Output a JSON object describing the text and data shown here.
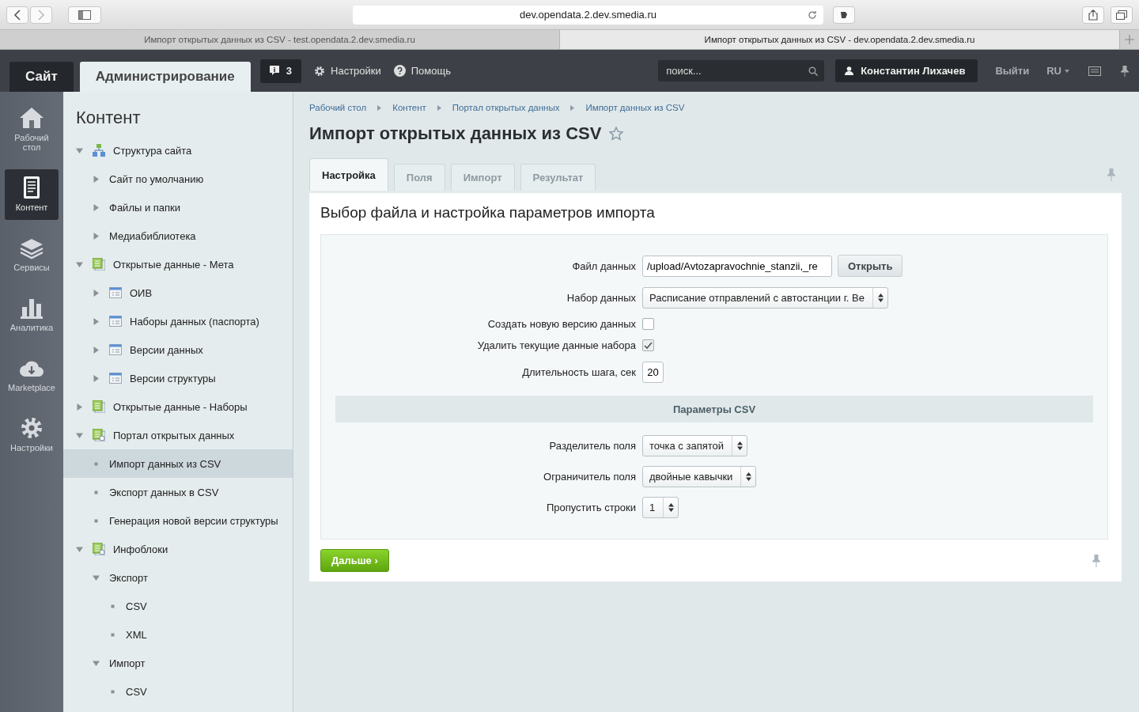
{
  "browser": {
    "url": "dev.opendata.2.dev.smedia.ru",
    "tabs": [
      {
        "title": "Импорт открытых данных из CSV - test.opendata.2.dev.smedia.ru",
        "selected": false
      },
      {
        "title": "Импорт открытых данных из CSV - dev.opendata.2.dev.smedia.ru",
        "selected": true
      }
    ]
  },
  "header": {
    "tabs": [
      {
        "label": "Сайт",
        "selected": false
      },
      {
        "label": "Администрирование",
        "selected": true
      }
    ],
    "notifications": "3",
    "settings": "Настройки",
    "help": "Помощь",
    "search": {
      "placeholder": "поиск..."
    },
    "user": "Константин Лихачев",
    "logout": "Выйти",
    "language": "RU"
  },
  "rail": [
    {
      "label": "Рабочий стол",
      "kind": "house",
      "selected": false
    },
    {
      "label": "Контент",
      "kind": "document",
      "selected": true
    },
    {
      "label": "Сервисы",
      "kind": "layers",
      "selected": false
    },
    {
      "label": "Аналитика",
      "kind": "chart",
      "selected": false
    },
    {
      "label": "Marketplace",
      "kind": "cloud",
      "selected": false
    },
    {
      "label": "Настройки",
      "kind": "gear",
      "selected": false
    }
  ],
  "sidebar": {
    "title": "Контент",
    "items": [
      {
        "label": "Структура сайта",
        "kind": "structure",
        "expanded": true,
        "selected": false,
        "children": [
          {
            "label": "Сайт по умолчанию",
            "kind": "plain",
            "expanded": false,
            "selected": false
          },
          {
            "label": "Файлы и папки",
            "kind": "plain",
            "expanded": false,
            "selected": false
          },
          {
            "label": "Медиабиблиотека",
            "kind": "plain",
            "expanded": false,
            "selected": false
          }
        ]
      },
      {
        "label": "Открытые данные - Мета",
        "kind": "module",
        "expanded": true,
        "selected": false,
        "children": [
          {
            "label": "ОИВ",
            "kind": "table",
            "expanded": false,
            "selected": false
          },
          {
            "label": "Наборы данных (паспорта)",
            "kind": "table",
            "expanded": false,
            "selected": false
          },
          {
            "label": "Версии данных",
            "kind": "table",
            "expanded": false,
            "selected": false
          },
          {
            "label": "Версии структуры",
            "kind": "table",
            "expanded": false,
            "selected": false
          }
        ]
      },
      {
        "label": "Открытые данные - Наборы",
        "kind": "module",
        "expanded": false,
        "selected": false
      },
      {
        "label": "Портал открытых данных",
        "kind": "portal",
        "expanded": true,
        "selected": false,
        "children": [
          {
            "label": "Импорт данных из CSV",
            "kind": "leaf",
            "selected": true
          },
          {
            "label": "Экспорт данных в CSV",
            "kind": "leaf",
            "selected": false
          },
          {
            "label": "Генерация новой версии структуры",
            "kind": "leaf",
            "selected": false
          }
        ]
      },
      {
        "label": "Инфоблоки",
        "kind": "portal",
        "expanded": true,
        "selected": false,
        "children": [
          {
            "label": "Экспорт",
            "kind": "plain",
            "expanded": true,
            "selected": false,
            "children": [
              {
                "label": "CSV",
                "kind": "leaf",
                "selected": false
              },
              {
                "label": "XML",
                "kind": "leaf",
                "selected": false
              }
            ]
          },
          {
            "label": "Импорт",
            "kind": "plain",
            "expanded": true,
            "selected": false,
            "children": [
              {
                "label": "CSV",
                "kind": "leaf",
                "selected": false
              }
            ]
          }
        ]
      }
    ]
  },
  "breadcrumbs": [
    "Рабочий стол",
    "Контент",
    "Портал открытых данных",
    "Импорт данных из CSV"
  ],
  "title": "Импорт открытых данных из CSV",
  "tabs": [
    {
      "label": "Настройка",
      "selected": true,
      "disabled": false
    },
    {
      "label": "Поля",
      "selected": false,
      "disabled": true
    },
    {
      "label": "Импорт",
      "selected": false,
      "disabled": true
    },
    {
      "label": "Результат",
      "selected": false,
      "disabled": true
    }
  ],
  "section_title": "Выбор файла и настройка параметров импорта",
  "form": [
    {
      "kind": "file",
      "label": "Файл данных",
      "value": "/upload/Avtozapravochnie_stanzii,_re",
      "button": "Открыть"
    },
    {
      "kind": "select",
      "label": "Набор данных",
      "value": "Расписание отправлений с автостанции г. Ве"
    },
    {
      "kind": "checkbox",
      "label": "Создать новую версию данных",
      "checked": false
    },
    {
      "kind": "checkbox",
      "label": "Удалить текущие данные набора",
      "checked": true
    },
    {
      "kind": "number",
      "label": "Длительность шага, сек",
      "value": "20"
    },
    {
      "kind": "heading",
      "label": "Параметры CSV"
    },
    {
      "kind": "select",
      "label": "Разделитель поля",
      "value": "точка с запятой"
    },
    {
      "kind": "select",
      "label": "Ограничитель поля",
      "value": "двойные кавычки"
    },
    {
      "kind": "select",
      "label": "Пропустить строки",
      "value": "1"
    }
  ],
  "next_button": "Дальше ›"
}
